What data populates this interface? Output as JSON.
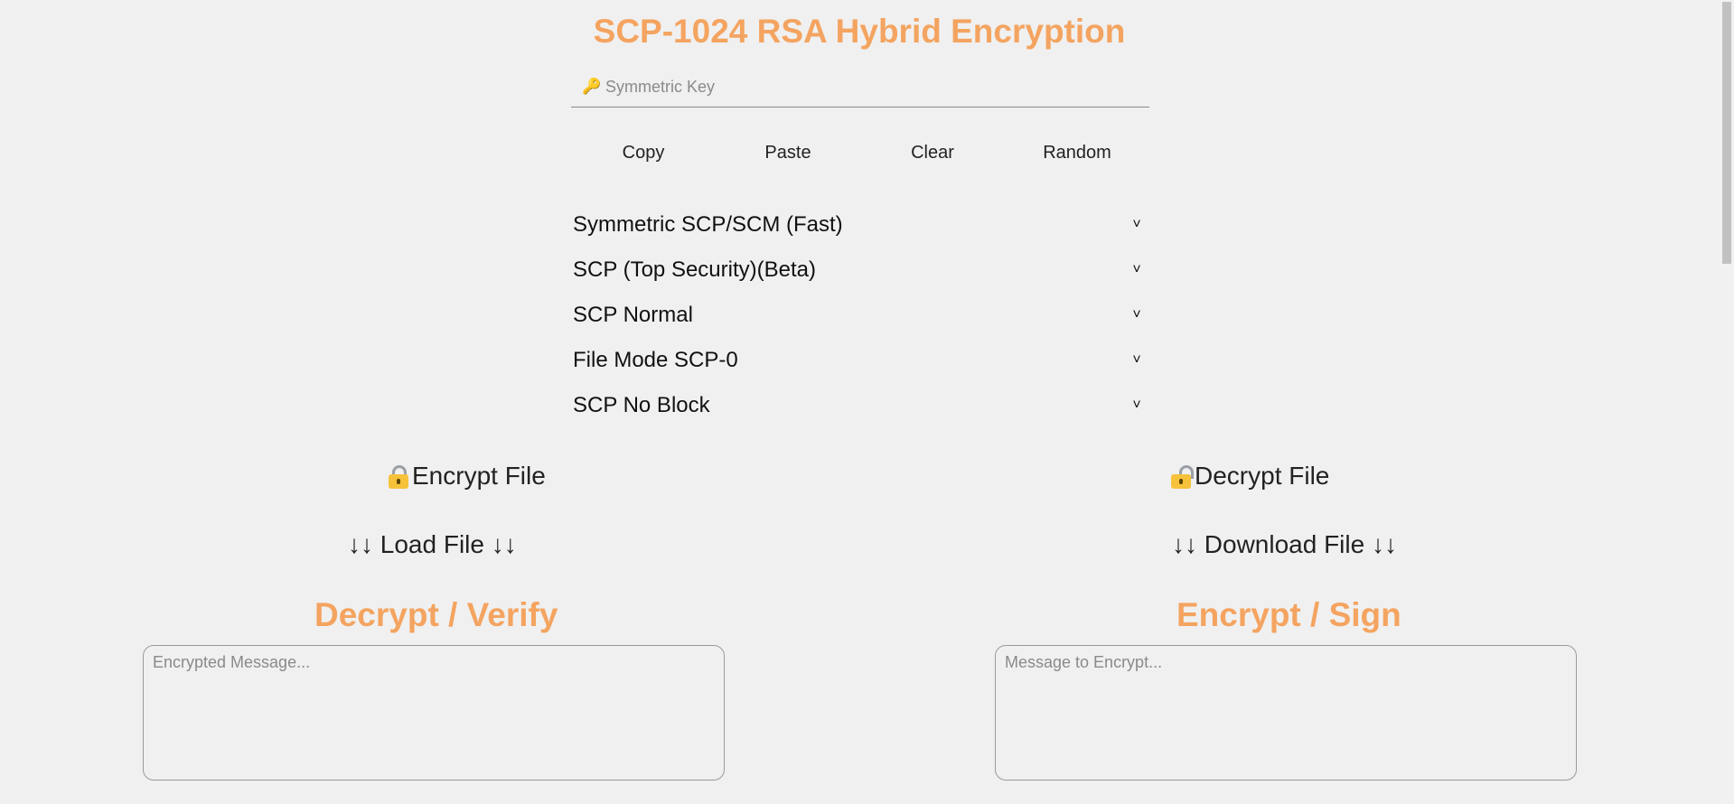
{
  "header": {
    "title": "SCP-1024 RSA Hybrid Encryption"
  },
  "key": {
    "placeholder": "Symmetric Key",
    "icon": "key-icon"
  },
  "key_buttons": {
    "copy": "Copy",
    "paste": "Paste",
    "clear": "Clear",
    "random": "Random"
  },
  "menu": {
    "items": [
      {
        "label": "Symmetric SCP/SCM (Fast)"
      },
      {
        "label": "SCP (Top Security)(Beta)"
      },
      {
        "label": "SCP Normal"
      },
      {
        "label": "File Mode SCP-0"
      },
      {
        "label": "SCP No Block"
      }
    ],
    "chevron": "˅"
  },
  "file_actions": {
    "encrypt_file": "Encrypt File",
    "decrypt_file": "Decrypt File",
    "load_file": "↓↓ Load File ↓↓",
    "download_file": "↓↓ Download File ↓↓"
  },
  "decrypt_section": {
    "title": "Decrypt / Verify",
    "placeholder": "Encrypted Message..."
  },
  "encrypt_section": {
    "title": "Encrypt / Sign",
    "placeholder": "Message to Encrypt..."
  },
  "colors": {
    "accent": "#f4a460",
    "background": "#f0f0f0"
  }
}
